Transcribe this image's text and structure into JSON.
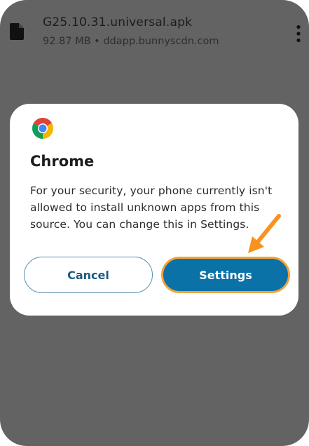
{
  "download": {
    "file_name": "G25.10.31.universal.apk",
    "meta": "92.87 MB • ddapp.bunnyscdn.com"
  },
  "dialog": {
    "app_name": "Chrome",
    "message": "For your security, your phone currently isn't allowed to install unknown apps from this source. You can change this in Settings.",
    "cancel_label": "Cancel",
    "settings_label": "Settings"
  },
  "icons": {
    "file": "file-icon",
    "more": "more-vertical-icon",
    "app": "chrome-icon",
    "annotation": "arrow-icon"
  },
  "colors": {
    "backdrop": "#636364",
    "primary": "#0b72a8",
    "highlight": "#f2a33a"
  }
}
